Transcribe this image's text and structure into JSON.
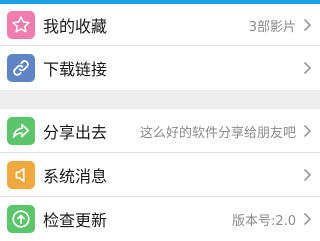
{
  "colors": {
    "top_bar": "#1ea0e6",
    "favorites_icon_bg": "#f07dab",
    "links_icon_bg": "#5f84c5",
    "share_icon_bg": "#5cc46a",
    "messages_icon_bg": "#f0a93e",
    "update_icon_bg": "#5cc46a",
    "value_text": "#8a8a8a"
  },
  "group1": {
    "items": [
      {
        "icon": "star-icon",
        "label": "我的收藏",
        "value": "3部影片"
      },
      {
        "icon": "link-icon",
        "label": "下载链接",
        "value": ""
      }
    ]
  },
  "group2": {
    "items": [
      {
        "icon": "share-icon",
        "label": "分享出去",
        "value": "这么好的软件分享给朋友吧"
      },
      {
        "icon": "speaker-icon",
        "label": "系统消息",
        "value": ""
      },
      {
        "icon": "upload-arrow-icon",
        "label": "检查更新",
        "value": "版本号:2.0"
      }
    ]
  }
}
